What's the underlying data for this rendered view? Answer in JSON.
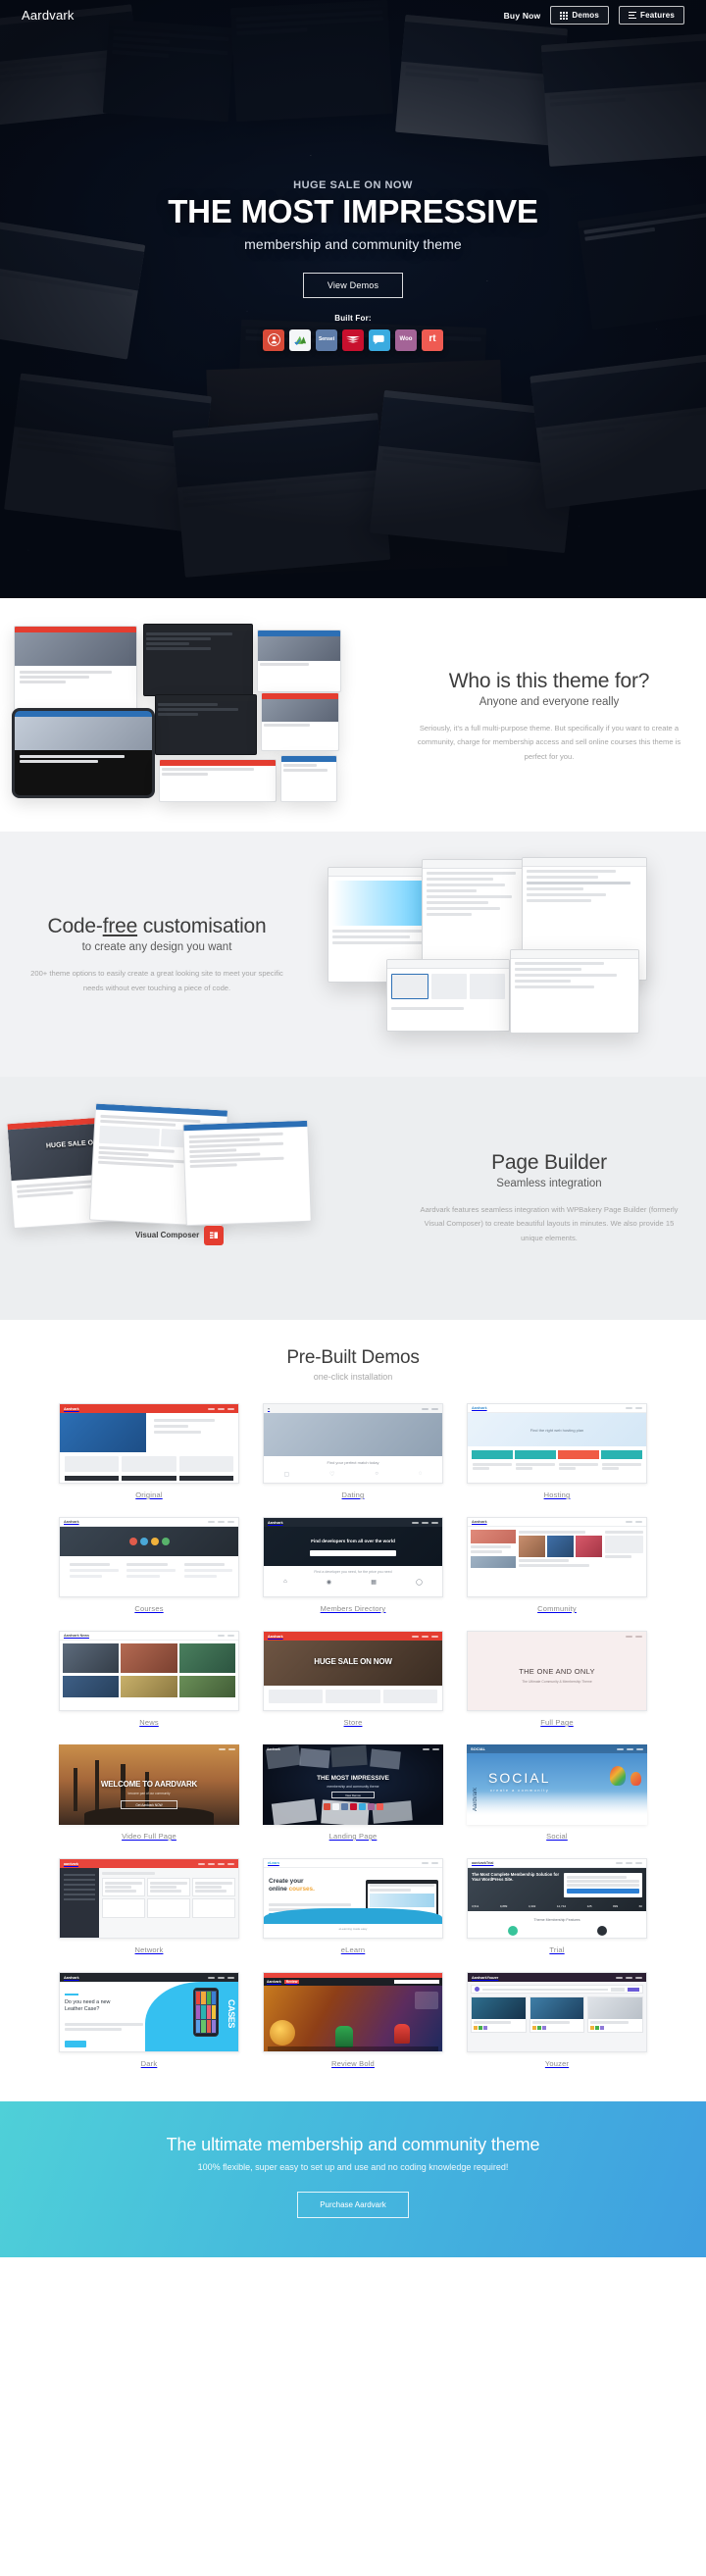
{
  "header": {
    "brand": "Aardvark",
    "buy_now": "Buy Now",
    "demos_button": "Demos",
    "features_button": "Features"
  },
  "hero": {
    "eyebrow": "HUGE SALE ON NOW",
    "title": "THE MOST IMPRESSIVE",
    "subtitle": "membership and community theme",
    "cta": "View Demos",
    "built_for_label": "Built For:",
    "plugins": [
      {
        "name": "BuddyPress",
        "short": ""
      },
      {
        "name": "LearnDash",
        "short": ""
      },
      {
        "name": "Sensei",
        "short": "Sensei"
      },
      {
        "name": "LayerSlider",
        "short": "LAYER SLIDER"
      },
      {
        "name": "bbPress",
        "short": ""
      },
      {
        "name": "WooCommerce",
        "short": "Woo"
      },
      {
        "name": "rtMedia",
        "short": "rt"
      }
    ]
  },
  "section_audience": {
    "title": "Who is this theme for?",
    "subtitle": "Anyone and everyone really",
    "body": "Seriously, it's a full multi-purpose theme. But specifically if you want to create a community, charge for membership access and sell online courses this theme is perfect for you."
  },
  "section_customisation": {
    "title_pre": "Code-",
    "title_underline": "free",
    "title_post": " customisation",
    "subtitle": "to create any design you want",
    "body": "200+ theme options to easily create a great looking site to meet your specific needs without ever touching a piece of code."
  },
  "section_pagebuilder": {
    "title": "Page Builder",
    "subtitle": "Seamless integration",
    "body": "Aardvark features seamless integration with WPBakery Page Builder (formerly Visual Composer) to create beautiful layouts in minutes. We also provide 15 unique elements.",
    "badge": "Visual Composer"
  },
  "section_demos": {
    "title": "Pre-Built Demos",
    "subtitle": "one-click installation",
    "items": [
      {
        "label": "Original"
      },
      {
        "label": "Dating"
      },
      {
        "label": "Hosting"
      },
      {
        "label": "Courses"
      },
      {
        "label": "Members Directory"
      },
      {
        "label": "Community"
      },
      {
        "label": "News"
      },
      {
        "label": "Store"
      },
      {
        "label": "Full Page"
      },
      {
        "label": "Video Full Page"
      },
      {
        "label": "Landing Page"
      },
      {
        "label": "Social"
      },
      {
        "label": "Network"
      },
      {
        "label": "eLearn"
      },
      {
        "label": "Trial"
      },
      {
        "label": "Dark"
      },
      {
        "label": "Review Bold"
      },
      {
        "label": "Youzer"
      }
    ],
    "thumb_text": {
      "video_full_page": "WELCOME TO AARDVARK",
      "landing_page_title": "THE MOST IMPRESSIVE",
      "landing_page_sub": "membership and community theme",
      "social_title": "SOCIAL",
      "social_sub": "create a community",
      "social_brand": "Aardvark",
      "elearn_line1": "Create your",
      "elearn_line2": "online ",
      "elearn_highlight": "courses.",
      "trial_headline": "The Most Complete Membership Solution for Your WordPress Site.",
      "trial_footer": "Theme Membership Features",
      "dark_line1": "Do you need a new",
      "dark_line2": "Leather Case?",
      "dark_side": "CASES",
      "full_page_title": "THE ONE AND ONLY",
      "full_page_sub": "The Ultimate Community & Membership Theme",
      "store_banner": "HUGE SALE ON NOW",
      "review_brand": "Aardvark",
      "review_tag": "Review"
    }
  },
  "cta": {
    "title": "The ultimate membership and community theme",
    "subtitle": "100% flexible, super easy to set up and use and no coding knowledge required!",
    "button": "Purchase Aardvark"
  },
  "colors": {
    "accent_red": "#e43d30",
    "accent_blue": "#2c6fb5",
    "cta_gradient_start": "#4fd0d8",
    "cta_gradient_end": "#3f9fe0"
  }
}
